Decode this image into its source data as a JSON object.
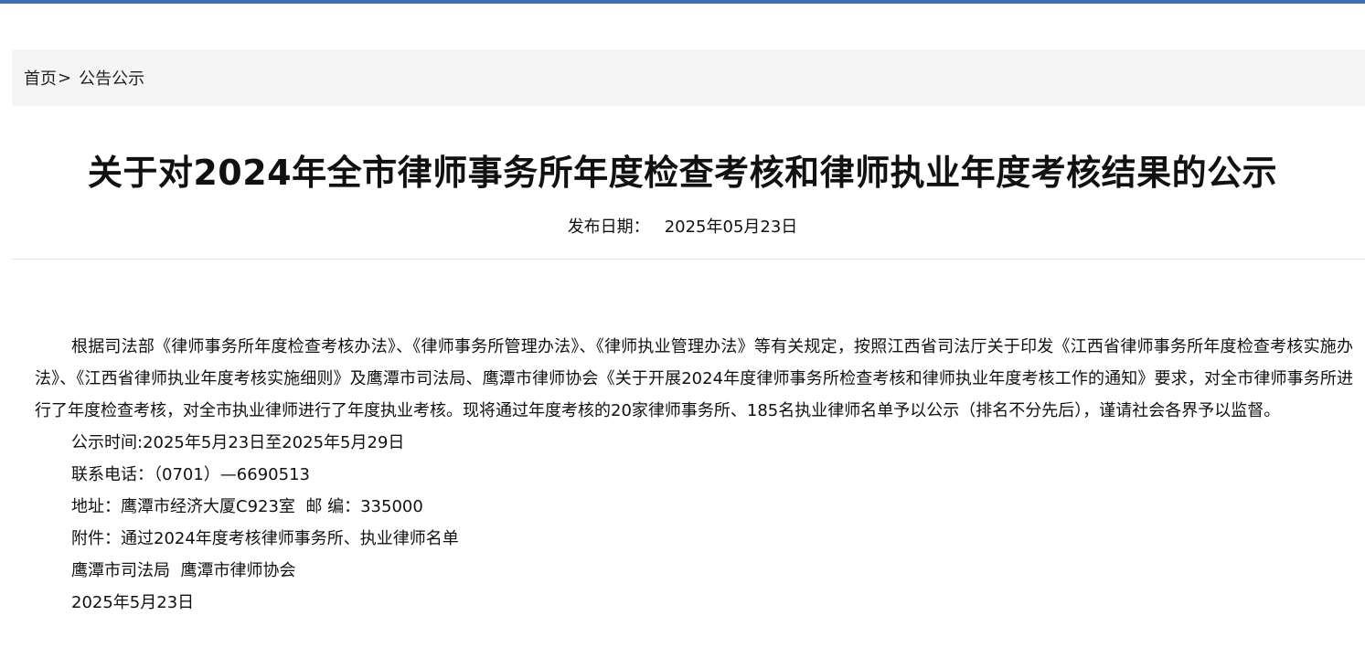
{
  "breadcrumb": {
    "home": "首页",
    "separator": ">",
    "current": "公告公示"
  },
  "article": {
    "title": "关于对2024年全市律师事务所年度检查考核和律师执业年度考核结果的公示",
    "date_label": "发布日期：",
    "date_value": "2025年05月23日",
    "body": "根据司法部《律师事务所年度检查考核办法》、《律师事务所管理办法》、《律师执业管理办法》等有关规定，按照江西省司法厅关于印发《江西省律师事务所年度检查考核实施办法》、《江西省律师执业年度考核实施细则》及鹰潭市司法局、鹰潭市律师协会《关于开展2024年度律师事务所检查考核和律师执业年度考核工作的通知》要求，对全市律师事务所进行了年度检查考核，对全市执业律师进行了年度执业考核。现将通过年度考核的20家律师事务所、185名执业律师名单予以公示（排名不分先后），谨请社会各界予以监督。",
    "period": "公示时间:2025年5月23日至2025年5月29日",
    "phone": "联系电话：（0701）—6690513",
    "address": "地址：鹰潭市经济大厦C923室  邮 编：335000",
    "attachment_label": "附件：",
    "attachment_link": "通过2024年度考核律师事务所、执业律师名单",
    "signature": "鹰潭市司法局  鹰潭市律师协会",
    "sign_date": "2025年5月23日"
  },
  "colors": {
    "top_bar": "#3d6fb3",
    "breadcrumb_bg": "#f5f5f5",
    "divider": "#e2e2e2"
  }
}
